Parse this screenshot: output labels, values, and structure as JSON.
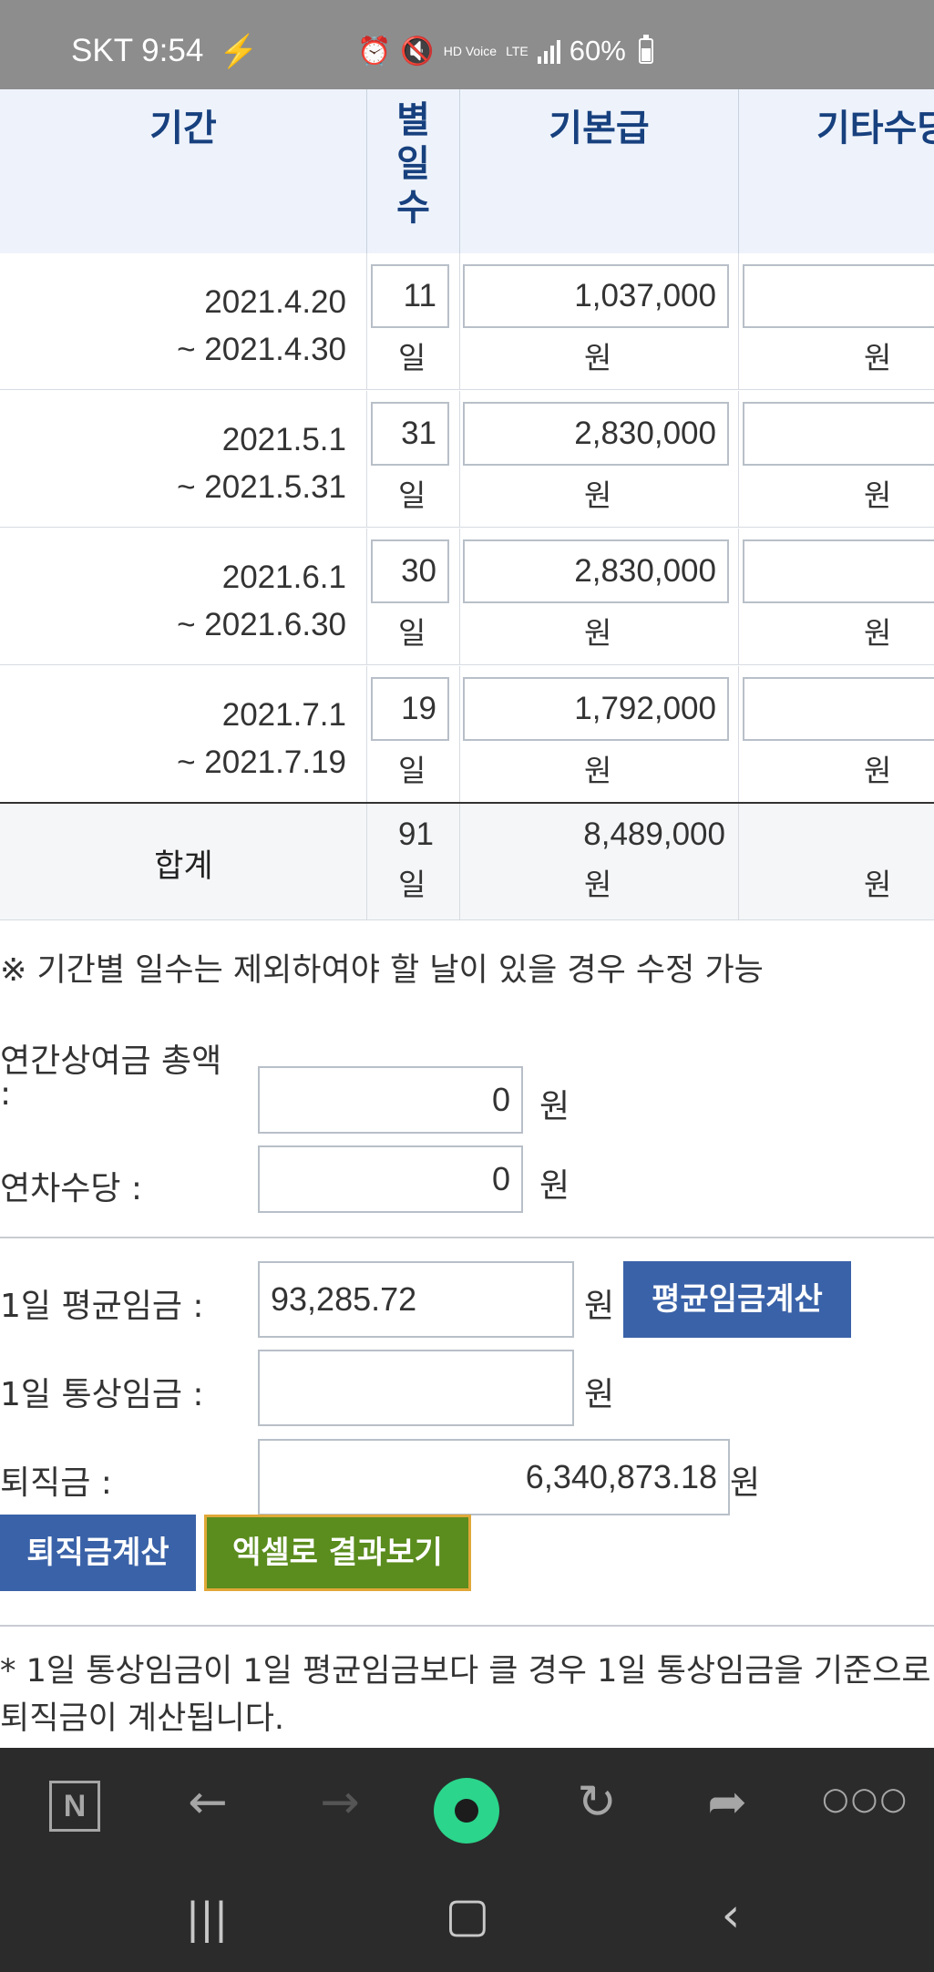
{
  "status_bar": {
    "carrier_time": "SKT 9:54",
    "hd_voice": "HD Voice",
    "lte": "LTE",
    "battery": "60%"
  },
  "table": {
    "headers": {
      "period": "기간",
      "days": "별\n일\n수",
      "base_pay": "기본급",
      "other_allowance": "기타수당"
    },
    "rows": [
      {
        "period_start": "2021.4.20",
        "period_end": "~ 2021.4.30",
        "days": "11",
        "days_unit": "일",
        "base": "1,037,000",
        "base_unit": "원",
        "other": "",
        "other_unit": "원"
      },
      {
        "period_start": "2021.5.1",
        "period_end": "~ 2021.5.31",
        "days": "31",
        "days_unit": "일",
        "base": "2,830,000",
        "base_unit": "원",
        "other": "",
        "other_unit": "원"
      },
      {
        "period_start": "2021.6.1",
        "period_end": "~ 2021.6.30",
        "days": "30",
        "days_unit": "일",
        "base": "2,830,000",
        "base_unit": "원",
        "other": "",
        "other_unit": "원"
      },
      {
        "period_start": "2021.7.1",
        "period_end": "~ 2021.7.19",
        "days": "19",
        "days_unit": "일",
        "base": "1,792,000",
        "base_unit": "원",
        "other": "",
        "other_unit": "원"
      }
    ],
    "total": {
      "label": "합계",
      "days": "91",
      "days_unit": "일",
      "base": "8,489,000",
      "base_unit": "원",
      "other_unit": "원"
    }
  },
  "note_days": "※ 기간별 일수는 제외하여야 할 날이 있을 경우 수정 가능",
  "bonus": {
    "label_line1": "연간상여금 총액",
    "label_line2": ":",
    "value": "0",
    "unit": "원"
  },
  "annual_leave": {
    "label": "연차수당 :",
    "value": "0",
    "unit": "원"
  },
  "avg_wage": {
    "label": "1일 평균임금 :",
    "value": "93,285.72",
    "unit": "원",
    "button": "평균임금계산"
  },
  "ordinary_wage": {
    "label": "1일 통상임금 :",
    "value": "",
    "unit": "원"
  },
  "severance": {
    "label": "퇴직금 :",
    "value": "6,340,873.18",
    "unit": "원"
  },
  "buttons": {
    "calc": "퇴직금계산",
    "excel": "엑셀로 결과보기"
  },
  "footnote": {
    "line1": "* 1일 통상임금이 1일 평균임금보다 클 경우 1일 통상임금을 기준으로",
    "line2": "퇴직금이 계산됩니다."
  },
  "browser": {
    "n_label": "N"
  }
}
